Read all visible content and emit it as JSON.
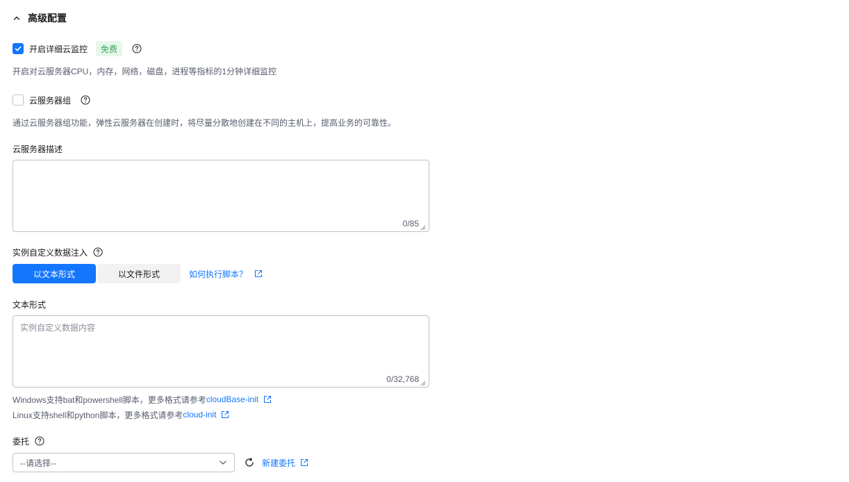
{
  "section": {
    "title": "高级配置"
  },
  "monitoring": {
    "label": "开启详细云监控",
    "checked": true,
    "badge": "免费",
    "description": "开启对云服务器CPU，内存，网络，磁盘，进程等指标的1分钟详细监控"
  },
  "server_group": {
    "label": "云服务器组",
    "checked": false,
    "description": "通过云服务器组功能，弹性云服务器在创建时，将尽量分散地创建在不同的主机上，提高业务的可靠性。"
  },
  "server_description": {
    "label": "云服务器描述",
    "value": "",
    "counter": "0/85"
  },
  "user_data": {
    "label": "实例自定义数据注入",
    "modes": [
      {
        "label": "以文本形式",
        "active": true
      },
      {
        "label": "以文件形式",
        "active": false
      }
    ],
    "help_link": "如何执行脚本？",
    "text_label": "文本形式",
    "text_placeholder": "实例自定义数据内容",
    "text_counter": "0/32,768",
    "windows_hint": "Windows支持bat和powershell脚本，更多格式请参考",
    "windows_link": "cloudBase-init",
    "linux_hint": "Linux支持shell和python脚本，更多格式请参考",
    "linux_link": "cloud-init"
  },
  "agency": {
    "label": "委托",
    "select_value": "--请选择--",
    "create_link": "新建委托"
  },
  "colors": {
    "primary": "#1476ff",
    "badge_bg": "#e8f7ec",
    "badge_text": "#3ba55c",
    "border": "#c2c2c2",
    "muted_text": "#575d6c"
  }
}
